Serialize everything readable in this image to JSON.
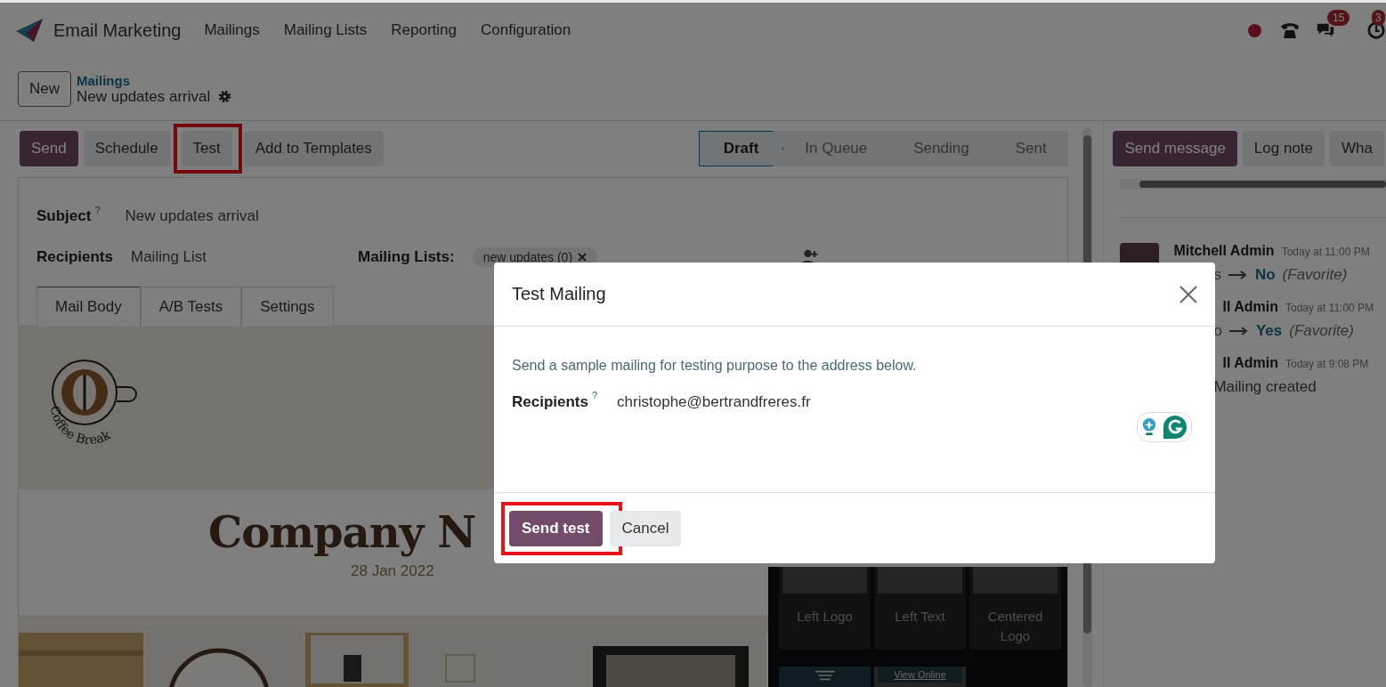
{
  "app": {
    "name": "Email Marketing",
    "menu": [
      "Mailings",
      "Mailing Lists",
      "Reporting",
      "Configuration"
    ]
  },
  "systray": {
    "chat_count": "15",
    "activity_count": "3"
  },
  "breadcrumb": {
    "new_button": "New",
    "parent": "Mailings",
    "current": "New updates arrival"
  },
  "actions": [
    {
      "label": "Send",
      "kind": "primary",
      "highlighted": false
    },
    {
      "label": "Schedule",
      "kind": "secondary",
      "highlighted": false
    },
    {
      "label": "Test",
      "kind": "secondary",
      "highlighted": true
    },
    {
      "label": "Add to Templates",
      "kind": "secondary",
      "highlighted": false
    }
  ],
  "stages": [
    {
      "label": "Draft",
      "selected": true
    },
    {
      "label": "In Queue",
      "selected": false
    },
    {
      "label": "Sending",
      "selected": false
    },
    {
      "label": "Sent",
      "selected": false
    }
  ],
  "form": {
    "subject_label": "Subject",
    "subject_help": "?",
    "subject": "New updates arrival",
    "recipients_label": "Recipients",
    "recipients": "Mailing List",
    "lists_label": "Mailing Lists:",
    "list_tags": [
      "new updates (0)"
    ],
    "tabs": [
      {
        "label": "Mail Body",
        "selected": true
      },
      {
        "label": "A/B Tests",
        "selected": false
      },
      {
        "label": "Settings",
        "selected": false
      }
    ]
  },
  "mail_body": {
    "logo_text": "Coffee Break",
    "headline": "Company N",
    "date": "28 Jan 2022"
  },
  "snippets": {
    "items": [
      "Left Logo",
      "Left Text",
      "Centered Logo"
    ],
    "view_online": "View Online"
  },
  "chatter": {
    "buttons": [
      {
        "label": "Send message",
        "kind": "primary"
      },
      {
        "label": "Log note",
        "kind": "secondary"
      },
      {
        "label": "Wha",
        "kind": "secondary"
      }
    ],
    "messages": [
      {
        "kind": "tracking",
        "author": "Mitchell Admin",
        "time": "Today at 11:00 PM",
        "old": "s",
        "new": "No",
        "field": "(Favorite)"
      },
      {
        "kind": "tracking",
        "author": "ll Admin",
        "time": "Today at 11:00 PM",
        "old": "o",
        "new": "Yes",
        "field": "(Favorite)"
      },
      {
        "kind": "note",
        "author": "ll Admin",
        "time": "Today at 9:08 PM",
        "body": "Mailing created"
      }
    ]
  },
  "dialog": {
    "title": "Test Mailing",
    "description": "Send a sample mailing for testing purpose to the address below.",
    "recipients_label": "Recipients",
    "help": "?",
    "recipients": "christophe@bertrandfreres.fr",
    "buttons": [
      {
        "label": "Send test",
        "kind": "primary",
        "highlighted": true
      },
      {
        "label": "Cancel",
        "kind": "secondary",
        "highlighted": false
      }
    ]
  }
}
